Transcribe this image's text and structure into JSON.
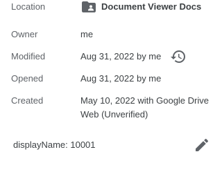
{
  "details": {
    "location": {
      "label": "Location",
      "value": "Document Viewer Docs",
      "icon": "shared-folder-icon"
    },
    "owner": {
      "label": "Owner",
      "value": "me"
    },
    "modified": {
      "label": "Modified",
      "value": "Aug 31, 2022 by me",
      "icon": "history-icon"
    },
    "opened": {
      "label": "Opened",
      "value": "Aug 31, 2022 by me"
    },
    "created": {
      "label": "Created",
      "value": "May 10, 2022 with Google Drive Web (Unverified)"
    }
  },
  "custom_property": {
    "text": "displayName: 10001",
    "icon": "edit-icon"
  },
  "colors": {
    "label": "#5f6368",
    "value": "#3c4043",
    "icon": "#5f6368"
  }
}
